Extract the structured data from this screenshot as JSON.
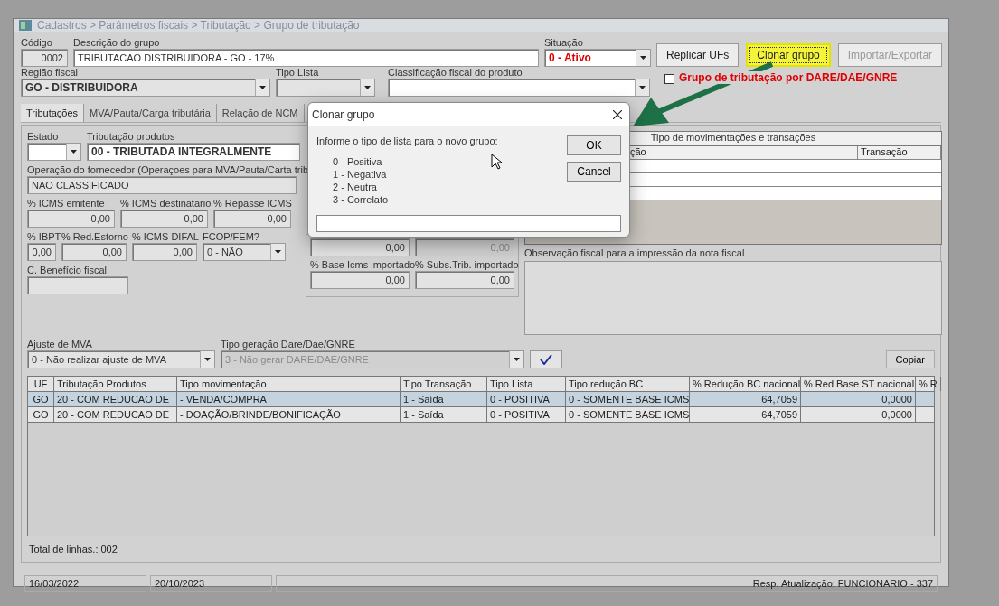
{
  "window": {
    "title": "Cadastros > Parâmetros fiscais > Tributação > Grupo de tributação"
  },
  "header": {
    "code": {
      "label": "Código",
      "value": "0002"
    },
    "description": {
      "label": "Descrição do grupo",
      "value": "TRIBUTACAO DISTRIBUIDORA - GO - 17%"
    },
    "situation": {
      "label": "Situação",
      "value": "0 - Ativo"
    },
    "buttons": [
      {
        "label": "Replicar UFs",
        "highlighted": false,
        "disabled": false
      },
      {
        "label": "Clonar grupo",
        "highlighted": true,
        "disabled": false
      },
      {
        "label": "Importar/Exportar",
        "highlighted": false,
        "disabled": true
      }
    ],
    "region": {
      "label": "Região fiscal",
      "value": "GO - DISTRIBUIDORA"
    },
    "list_type": {
      "label": "Tipo Lista"
    },
    "classification": {
      "label": "Classificação fiscal do produto"
    },
    "dare_checkbox": {
      "label": "Grupo de tributação por DARE/DAE/GNRE",
      "checked": false
    }
  },
  "tabs": [
    {
      "label": "Tributações",
      "selected": true
    },
    {
      "label": "MVA/Pauta/Carga tributária",
      "selected": false
    },
    {
      "label": "Relação de NCM",
      "selected": false
    }
  ],
  "form": {
    "state": {
      "label": "Estado"
    },
    "product_tax": {
      "label": "Tributação produtos",
      "value": "00 - TRIBUTADA INTEGRALMENTE"
    },
    "supplier_op": {
      "label": "Operação do fornecedor (Operaçoes para MVA/Pauta/Carta trib",
      "value": "NAO CLASSIFICADO"
    },
    "row_icms": [
      {
        "label": "% ICMS emitente",
        "value": "0,00"
      },
      {
        "label": "% ICMS destinatario",
        "value": "0,00"
      },
      {
        "label": "% Repasse ICMS",
        "value": "0,00"
      }
    ],
    "row_ibpt": [
      {
        "label": "% IBPT",
        "value": "0,00",
        "kind": "text"
      },
      {
        "label": "% Red.Estorno",
        "value": "0,00",
        "kind": "text"
      },
      {
        "label": "% ICMS DIFAL",
        "value": "0,00",
        "kind": "text"
      },
      {
        "label": "FCOP/FEM?",
        "value": "0 - NÃO",
        "kind": "combo"
      }
    ],
    "benefit": {
      "label": "C. Benefício fiscal"
    },
    "base_group": [
      {
        "value": "0,00",
        "disabled": false
      },
      {
        "value": "0,00",
        "disabled": true
      },
      {
        "label": "% Base Icms importado",
        "value": "0,00",
        "disabled": false
      },
      {
        "label": "% Subs.Trib. importado",
        "value": "0,00",
        "disabled": false
      }
    ],
    "mva_adjust": {
      "label": "Ajuste de MVA",
      "value": "0 - Não realizar ajuste de MVA",
      "disabled": false
    },
    "dare_type": {
      "label": "Tipo geração Dare/Dae/GNRE",
      "value": "3 - Não gerar DARE/DAE/GNRE",
      "disabled": true
    }
  },
  "movements": {
    "title": "Tipo de movimentações e transações",
    "columns": [
      "ção",
      "Transação"
    ]
  },
  "observation": {
    "label": "Observação fiscal para a impressão da nota fiscal"
  },
  "copy_button": "Copiar",
  "grid": {
    "columns": [
      "UF",
      "Tributação Produtos",
      "Tipo movimentação",
      "Tipo Transação",
      "Tipo Lista",
      "Tipo redução BC",
      "% Redução BC nacional",
      "% Red Base ST nacional",
      "% R"
    ],
    "rows": [
      {
        "selected": true,
        "cells": [
          "GO",
          "20 - COM REDUCAO DE",
          "- VENDA/COMPRA",
          "1 - Saída",
          "0 - POSITIVA",
          "0 - SOMENTE BASE ICMS",
          "64,7059",
          "0,0000"
        ]
      },
      {
        "selected": false,
        "cells": [
          "GO",
          "20 - COM REDUCAO DE",
          "- DOAÇÃO/BRINDE/BONIFICAÇÃO",
          "1 - Saída",
          "0 - POSITIVA",
          "0 - SOMENTE BASE ICMS",
          "64,7059",
          "0,0000"
        ]
      }
    ]
  },
  "total": "Total de linhas.: 002",
  "status_bar": [
    "16/03/2022",
    "20/10/2023",
    "Resp. Atualização: FUNCIONARIO - 337"
  ],
  "dialog": {
    "title": "Clonar grupo",
    "prompt": "Informe o tipo de lista para o novo grupo:",
    "options": [
      "0 - Positiva",
      "1 - Negativa",
      "2 - Neutra",
      "3 - Correlato"
    ],
    "buttons": [
      "OK",
      "Cancel"
    ]
  }
}
